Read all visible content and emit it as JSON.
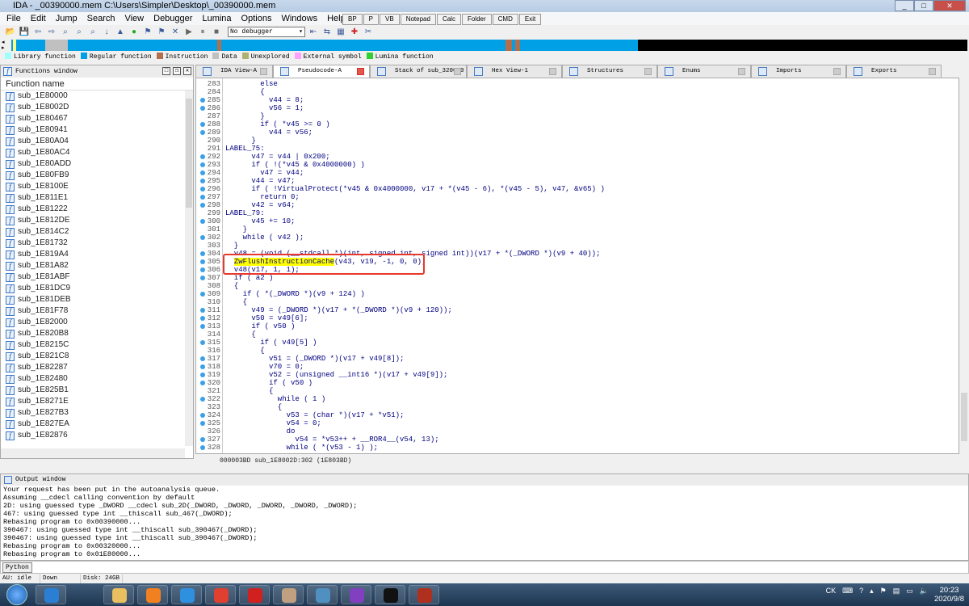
{
  "window": {
    "title": "IDA - _00390000.mem C:\\Users\\Simpler\\Desktop\\_00390000.mem"
  },
  "menu": [
    "File",
    "Edit",
    "Jump",
    "Search",
    "View",
    "Debugger",
    "Lumina",
    "Options",
    "Windows",
    "Help"
  ],
  "quick_buttons": [
    "BP",
    "P",
    "VB",
    "Notepad",
    "Calc",
    "Folder",
    "CMD",
    "Exit"
  ],
  "toolbar": {
    "debugger_select": "No debugger"
  },
  "legend": [
    {
      "label": "Library function",
      "color": "#a0ffff"
    },
    {
      "label": "Regular function",
      "color": "#00a0e6"
    },
    {
      "label": "Instruction",
      "color": "#b07050"
    },
    {
      "label": "Data",
      "color": "#c0c0c0"
    },
    {
      "label": "Unexplored",
      "color": "#b0b070"
    },
    {
      "label": "External symbol",
      "color": "#ffa0ff"
    },
    {
      "label": "Lumina function",
      "color": "#30d030"
    }
  ],
  "functions_window": {
    "title": "Functions window",
    "column": "Function name",
    "items": [
      "sub_1E80000",
      "sub_1E8002D",
      "sub_1E80467",
      "sub_1E80941",
      "sub_1E80A04",
      "sub_1E80AC4",
      "sub_1E80ADD",
      "sub_1E80FB9",
      "sub_1E8100E",
      "sub_1E811E1",
      "sub_1E81222",
      "sub_1E812DE",
      "sub_1E814C2",
      "sub_1E81732",
      "sub_1E819A4",
      "sub_1E81A82",
      "sub_1E81ABF",
      "sub_1E81DC9",
      "sub_1E81DEB",
      "sub_1E81F78",
      "sub_1E82000",
      "sub_1E820B8",
      "sub_1E8215C",
      "sub_1E821C8",
      "sub_1E82287",
      "sub_1E82480",
      "sub_1E825B1",
      "sub_1E8271E",
      "sub_1E827B3",
      "sub_1E827EA",
      "sub_1E82876"
    ]
  },
  "tabs": [
    {
      "label": "IDA View-A",
      "active": false
    },
    {
      "label": "Pseudocode-A",
      "active": true
    },
    {
      "label": "Stack of sub_320020",
      "active": false
    },
    {
      "label": "Hex View-1",
      "active": false
    },
    {
      "label": "Structures",
      "active": false
    },
    {
      "label": "Enums",
      "active": false
    },
    {
      "label": "Imports",
      "active": false
    },
    {
      "label": "Exports",
      "active": false
    }
  ],
  "code": [
    {
      "n": "283",
      "bp": false,
      "t": "        else"
    },
    {
      "n": "284",
      "bp": false,
      "t": "        {"
    },
    {
      "n": "285",
      "bp": true,
      "t": "          v44 = 8;"
    },
    {
      "n": "286",
      "bp": true,
      "t": "          v56 = 1;"
    },
    {
      "n": "287",
      "bp": false,
      "t": "        }"
    },
    {
      "n": "288",
      "bp": true,
      "t": "        if ( *v45 >= 0 )"
    },
    {
      "n": "289",
      "bp": true,
      "t": "          v44 = v56;"
    },
    {
      "n": "290",
      "bp": false,
      "t": "      }"
    },
    {
      "n": "291",
      "bp": false,
      "t": "LABEL_75:"
    },
    {
      "n": "292",
      "bp": true,
      "t": "      v47 = v44 | 0x200;"
    },
    {
      "n": "293",
      "bp": true,
      "t": "      if ( !(*v45 & 0x4000000) )"
    },
    {
      "n": "294",
      "bp": true,
      "t": "        v47 = v44;"
    },
    {
      "n": "295",
      "bp": true,
      "t": "      v44 = v47;"
    },
    {
      "n": "296",
      "bp": true,
      "t": "      if ( !VirtualProtect(*v45 & 0x4000000, v17 + *(v45 - 6), *(v45 - 5), v47, &v65) )"
    },
    {
      "n": "297",
      "bp": true,
      "t": "        return 0;"
    },
    {
      "n": "298",
      "bp": true,
      "t": "      v42 = v64;"
    },
    {
      "n": "299",
      "bp": false,
      "t": "LABEL_79:"
    },
    {
      "n": "300",
      "bp": true,
      "t": "      v45 += 10;"
    },
    {
      "n": "301",
      "bp": false,
      "t": "    }"
    },
    {
      "n": "302",
      "bp": true,
      "t": "    while ( v42 );"
    },
    {
      "n": "303",
      "bp": false,
      "t": "  }"
    },
    {
      "n": "304",
      "bp": true,
      "t": "  v48 = (void (__stdcall *)(int, signed int, signed int))(v17 + *(_DWORD *)(v9 + 40));"
    },
    {
      "n": "305",
      "bp": true,
      "t": "  ZwFlushInstructionCache(v43, v19, -1, 0, 0);",
      "highlight": "ZwFlushInstructionCache"
    },
    {
      "n": "306",
      "bp": true,
      "t": "  v48(v17, 1, 1);"
    },
    {
      "n": "307",
      "bp": true,
      "t": "  if ( a2 )"
    },
    {
      "n": "308",
      "bp": false,
      "t": "  {"
    },
    {
      "n": "309",
      "bp": true,
      "t": "    if ( *(_DWORD *)(v9 + 124) )"
    },
    {
      "n": "310",
      "bp": false,
      "t": "    {"
    },
    {
      "n": "311",
      "bp": true,
      "t": "      v49 = (_DWORD *)(v17 + *(_DWORD *)(v9 + 120));"
    },
    {
      "n": "312",
      "bp": true,
      "t": "      v50 = v49[6];"
    },
    {
      "n": "313",
      "bp": true,
      "t": "      if ( v50 )"
    },
    {
      "n": "314",
      "bp": false,
      "t": "      {"
    },
    {
      "n": "315",
      "bp": true,
      "t": "        if ( v49[5] )"
    },
    {
      "n": "316",
      "bp": false,
      "t": "        {"
    },
    {
      "n": "317",
      "bp": true,
      "t": "          v51 = (_DWORD *)(v17 + v49[8]);"
    },
    {
      "n": "318",
      "bp": true,
      "t": "          v70 = 0;"
    },
    {
      "n": "319",
      "bp": true,
      "t": "          v52 = (unsigned __int16 *)(v17 + v49[9]);"
    },
    {
      "n": "320",
      "bp": true,
      "t": "          if ( v50 )"
    },
    {
      "n": "321",
      "bp": false,
      "t": "          {"
    },
    {
      "n": "322",
      "bp": true,
      "t": "            while ( 1 )"
    },
    {
      "n": "323",
      "bp": false,
      "t": "            {"
    },
    {
      "n": "324",
      "bp": true,
      "t": "              v53 = (char *)(v17 + *v51);"
    },
    {
      "n": "325",
      "bp": true,
      "t": "              v54 = 0;"
    },
    {
      "n": "326",
      "bp": false,
      "t": "              do"
    },
    {
      "n": "327",
      "bp": true,
      "t": "                v54 = *v53++ + __ROR4__(v54, 13);"
    },
    {
      "n": "328",
      "bp": true,
      "t": "              while ( *(v53 - 1) );"
    }
  ],
  "code_status": "000003BD sub_1E8002D:302 (1E803BD)",
  "output_window": {
    "title": "Output window",
    "lines": [
      "Your request has been put in the autoanalysis queue.",
      "Assuming __cdecl calling convention by default",
      "2D: using guessed type _DWORD __cdecl sub_2D(_DWORD, _DWORD, _DWORD, _DWORD, _DWORD);",
      "467: using guessed type int __thiscall sub_467(_DWORD);",
      "Rebasing program to 0x00390000...",
      "390467: using guessed type int __thiscall sub_390467(_DWORD);",
      "390467: using guessed type int __thiscall sub_390467(_DWORD);",
      "Rebasing program to 0x00320000...",
      "Rebasing program to 0x01E80000..."
    ]
  },
  "python_button": "Python",
  "status": {
    "au": "AU:  idle",
    "dir": "Down",
    "disk": "Disk: 24GB"
  },
  "taskbar": {
    "lang": "CK",
    "time": "20:23",
    "date": "2020/9/8",
    "apps": [
      {
        "icon": "ie-icon",
        "color": "#2a7fd4"
      },
      {
        "icon": "folder-icon",
        "color": "#e8c060"
      },
      {
        "icon": "media-player-icon",
        "color": "#f08020"
      },
      {
        "icon": "qq-icon",
        "color": "#3090e0"
      },
      {
        "icon": "chrome-icon",
        "color": "#e04030"
      },
      {
        "icon": "app-red-icon",
        "color": "#d02020"
      },
      {
        "icon": "photo-icon",
        "color": "#c0a080"
      },
      {
        "icon": "network-icon",
        "color": "#5090c0"
      },
      {
        "icon": "hex-editor-icon",
        "color": "#8040c0"
      },
      {
        "icon": "7zip-icon",
        "color": "#111111"
      },
      {
        "icon": "ida-icon",
        "color": "#b03020"
      }
    ]
  }
}
